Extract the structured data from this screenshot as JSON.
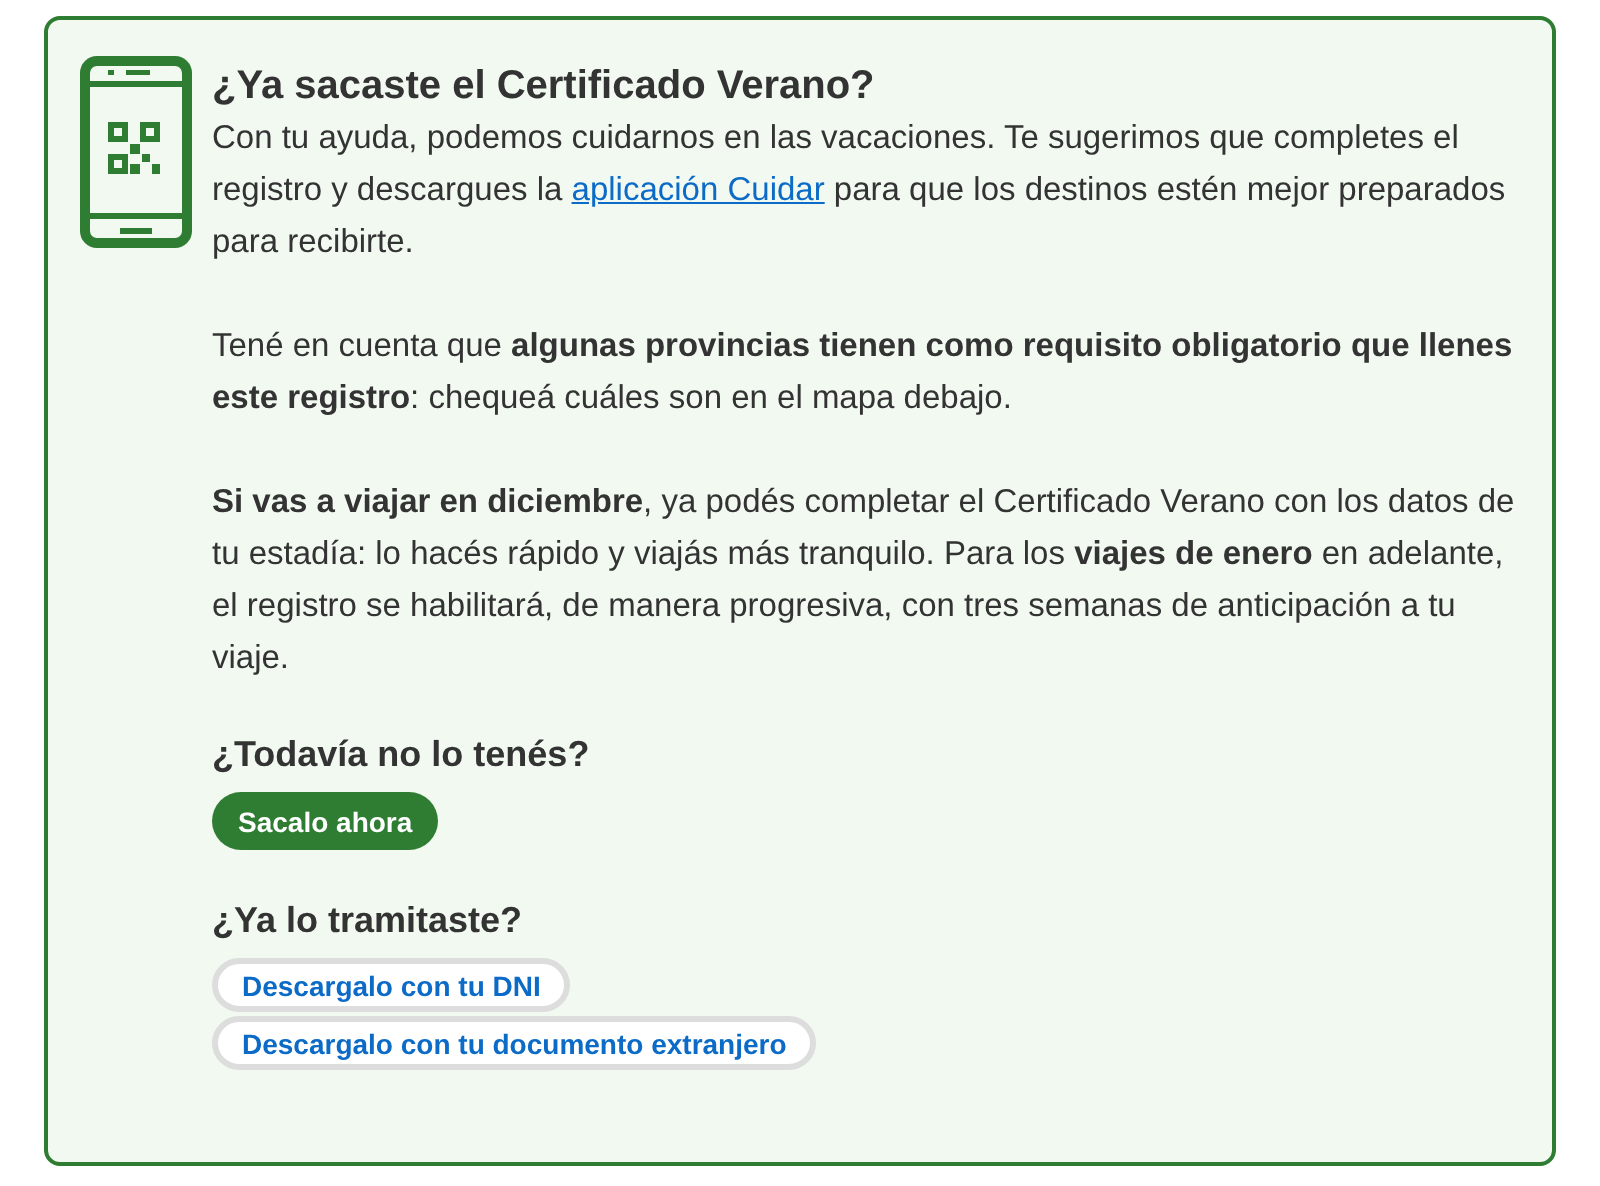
{
  "title": "¿Ya sacaste el Certificado Verano?",
  "intro": {
    "before": "Con tu ayuda, podemos cuidarnos en las vacaciones. Te sugerimos que completes el registro y descargues la",
    "link": "aplicación Cuidar",
    "after": "para que los destinos estén mejor preparados para recibirte."
  },
  "paragraphs": [
    "Tené en cuenta que **algunas provincias tienen como requisito obligatorio que llenes este registro**: chequeá cuáles son en el mapa debajo.",
    "**Si vas a viajar en diciembre**, ya podés completar el Certificado Verano con los datos de tu estadía: lo hacés rápido y viajás más tranquilo. Para los **viajes de enero** en adelante, el registro se habilitará, de manera progresiva, con tres semanas de anticipación a tu viaje."
  ],
  "sections": [
    {
      "heading": "¿Todavía no lo tenés?",
      "buttons": [
        {
          "label": "Sacalo ahora",
          "kind": "primary"
        }
      ]
    },
    {
      "heading": "¿Ya lo tramitaste?",
      "buttons": [
        {
          "label": "Descargalo con tu DNI",
          "kind": "outline"
        },
        {
          "label": "Descargalo con tu documento extranjero",
          "kind": "outline"
        }
      ]
    }
  ]
}
